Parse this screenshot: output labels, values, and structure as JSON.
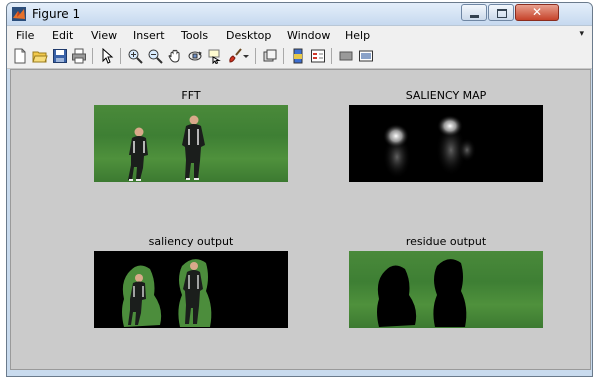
{
  "window": {
    "title": "Figure 1",
    "close_glyph": "✕"
  },
  "menu": [
    "File",
    "Edit",
    "View",
    "Insert",
    "Tools",
    "Desktop",
    "Window",
    "Help"
  ],
  "menu_overflow_glyph": "▾",
  "toolbar": {
    "icons": [
      "new-figure-icon",
      "open-file-icon",
      "save-icon",
      "print-icon",
      "pointer-icon",
      "zoom-in-icon",
      "zoom-out-icon",
      "pan-icon",
      "rotate-3d-icon",
      "data-cursor-icon",
      "brush-icon",
      "brush-dropdown-icon",
      "link-plot-icon",
      "colorbar-icon",
      "legend-icon",
      "hide-plot-tools-icon",
      "show-plot-tools-icon"
    ]
  },
  "panels": {
    "fft": {
      "title": "FFT"
    },
    "saliency_map": {
      "title": "SALIENCY MAP"
    },
    "saliency_output": {
      "title": "saliency output"
    },
    "residue_output": {
      "title": "residue output"
    }
  },
  "colors": {
    "grass": "#478a38",
    "figure_bg": "#cbcbcb",
    "titlebar": "#c6d9ef"
  }
}
